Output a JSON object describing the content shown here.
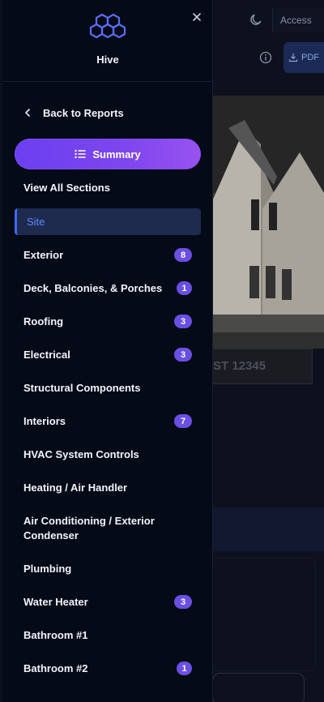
{
  "background": {
    "access_label": "Access",
    "pdf_label": "PDF",
    "banner_text": "ST 12345"
  },
  "drawer": {
    "brand": "Hive",
    "back_label": "Back to Reports",
    "summary_label": "Summary",
    "view_all_label": "View All Sections",
    "items": [
      {
        "label": "Site",
        "count": "",
        "active": true
      },
      {
        "label": "Exterior",
        "count": "8"
      },
      {
        "label": "Deck, Balconies, & Porches",
        "count": "1"
      },
      {
        "label": "Roofing",
        "count": "3"
      },
      {
        "label": "Electrical",
        "count": "3"
      },
      {
        "label": "Structural Components",
        "count": ""
      },
      {
        "label": "Interiors",
        "count": "7"
      },
      {
        "label": "HVAC System Controls",
        "count": ""
      },
      {
        "label": "Heating / Air Handler",
        "count": ""
      },
      {
        "label": "Air Conditioning / Exterior Condenser",
        "count": ""
      },
      {
        "label": "Plumbing",
        "count": ""
      },
      {
        "label": "Water Heater",
        "count": "3"
      },
      {
        "label": "Bathroom #1",
        "count": ""
      },
      {
        "label": "Bathroom #2",
        "count": "1"
      }
    ]
  },
  "colors": {
    "accent": "#6b4fe4",
    "active_bg": "#1e2a4e",
    "active_text": "#5b8cff",
    "drawer_bg": "#050a17"
  }
}
